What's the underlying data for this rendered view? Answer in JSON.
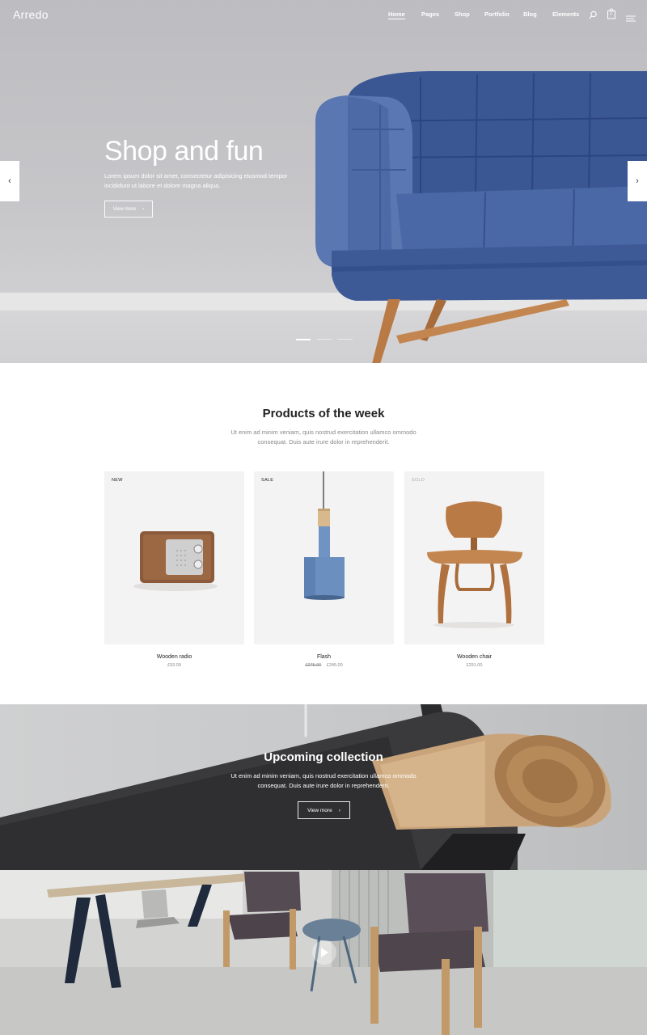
{
  "nav": {
    "logo": "Arredo",
    "items": [
      "Home",
      "Pages",
      "Shop",
      "Portfolio",
      "Blog",
      "Elements"
    ],
    "active": "Home",
    "cart_count": "2",
    "icons": [
      "search-icon",
      "cart-icon",
      "menu-icon"
    ]
  },
  "hero": {
    "title": "Shop and fun",
    "text": "Lorem ipsum dolor sit amet, consectetur adipisicing eiusmod tempor incididunt ut labore et dolore magna aliqua.",
    "button": "View more",
    "prev": "‹",
    "next": "›",
    "slides": 3,
    "active_slide": 1
  },
  "products": {
    "title": "Products of the week",
    "subtitle": "Ut enim ad minim veniam, quis nostrud exercitation ullamco ommodo consequat. Duis aute irure dolor in reprehenderit.",
    "items": [
      {
        "badge": "NEW",
        "name": "Wooden radio",
        "price": "£93.00",
        "old_price": ""
      },
      {
        "badge": "SALE",
        "name": "Flash",
        "price": "£245.00",
        "old_price": "£275.00"
      },
      {
        "badge": "SOLD",
        "name": "Wooden chair",
        "price": "£291.00",
        "old_price": ""
      }
    ]
  },
  "upcoming": {
    "title": "Upcoming collection",
    "text": "Ut enim ad minim veniam, quis nostrud exercitation ullamco ommodo consequat. Duis aute irure dolor in reprehenderit.",
    "button": "View more"
  },
  "colors": {
    "sofa": "#3d5a96",
    "sofa_light": "#5a76b0",
    "lamp": "#6f93c2",
    "wood": "#b97a45",
    "accent_white": "#ffffff"
  }
}
